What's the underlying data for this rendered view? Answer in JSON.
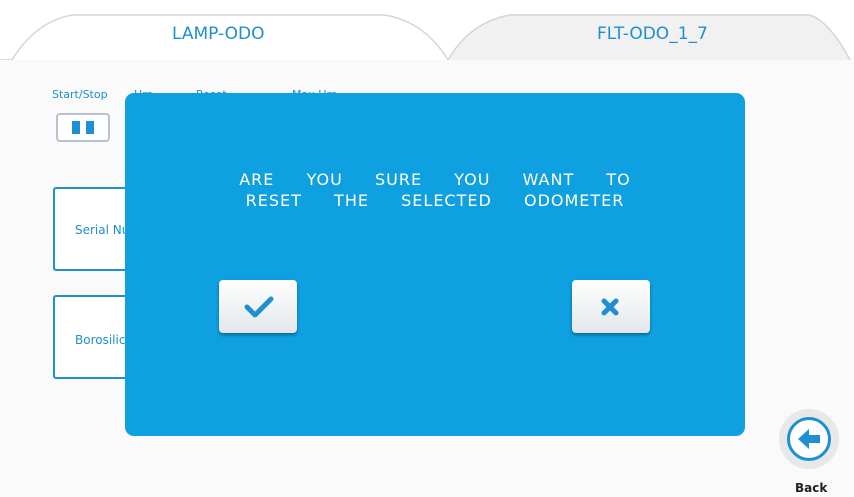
{
  "tabs": [
    {
      "label": "LAMP-ODO",
      "active": true
    },
    {
      "label": "FLT-ODO_1_7",
      "active": false
    }
  ],
  "table_headers": [
    "Start/Stop",
    "Hrs",
    "Reset",
    "Max Hrs"
  ],
  "cards": [
    {
      "label": "Serial Nu"
    },
    {
      "label": "Borosilic"
    }
  ],
  "dialog": {
    "line1": "ARE  YOU  SURE  YOU  WANT  TO",
    "line2": "RESET  THE  SELECTED  ODOMETER",
    "confirm_icon": "checkmark-icon",
    "cancel_icon": "x-icon"
  },
  "back": {
    "label": "Back",
    "icon": "arrow-left-icon"
  },
  "colors": {
    "accent": "#1e8fd0",
    "dialog_bg": "#0ea0e0",
    "background": "#ffffff"
  }
}
